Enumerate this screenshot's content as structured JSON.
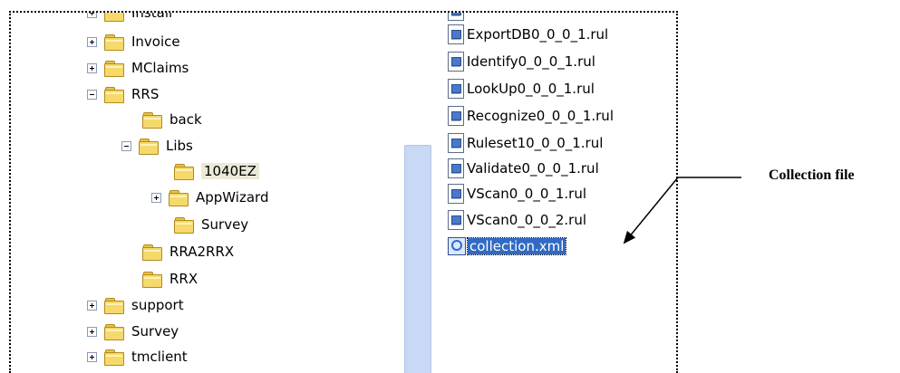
{
  "tree": {
    "nodes": [
      {
        "label": "Install",
        "expander": "plus"
      },
      {
        "label": "Invoice",
        "expander": "plus"
      },
      {
        "label": "MClaims",
        "expander": "plus"
      },
      {
        "label": "RRS",
        "expander": "minus"
      },
      {
        "label": "back",
        "expander": "none"
      },
      {
        "label": "Libs",
        "expander": "minus"
      },
      {
        "label": "1040EZ",
        "expander": "none",
        "selected": true
      },
      {
        "label": "AppWizard",
        "expander": "plus"
      },
      {
        "label": "Survey",
        "expander": "none"
      },
      {
        "label": "RRA2RRX",
        "expander": "none"
      },
      {
        "label": "RRX",
        "expander": "none"
      },
      {
        "label": "support",
        "expander": "plus"
      },
      {
        "label": "Survey",
        "expander": "plus"
      },
      {
        "label": "tmclient",
        "expander": "plus"
      }
    ]
  },
  "files": {
    "items": [
      {
        "name": "ExportDB0_0_0_1.rul",
        "icon": "rul-file-icon"
      },
      {
        "name": "Identify0_0_0_1.rul",
        "icon": "rul-file-icon"
      },
      {
        "name": "LookUp0_0_0_1.rul",
        "icon": "rul-file-icon"
      },
      {
        "name": "Recognize0_0_0_1.rul",
        "icon": "rul-file-icon"
      },
      {
        "name": "Ruleset10_0_0_1.rul",
        "icon": "rul-file-icon"
      },
      {
        "name": "Validate0_0_0_1.rul",
        "icon": "rul-file-icon"
      },
      {
        "name": "VScan0_0_0_1.rul",
        "icon": "rul-file-icon"
      },
      {
        "name": "VScan0_0_0_2.rul",
        "icon": "rul-file-icon"
      },
      {
        "name": "collection.xml",
        "icon": "xml-file-icon",
        "selected": true
      }
    ]
  },
  "annotation": {
    "caption": "Collection file"
  },
  "colors": {
    "selection": "#316ac5",
    "folder": "#f6d96b",
    "scroll_thumb": "#c9d8f5"
  }
}
